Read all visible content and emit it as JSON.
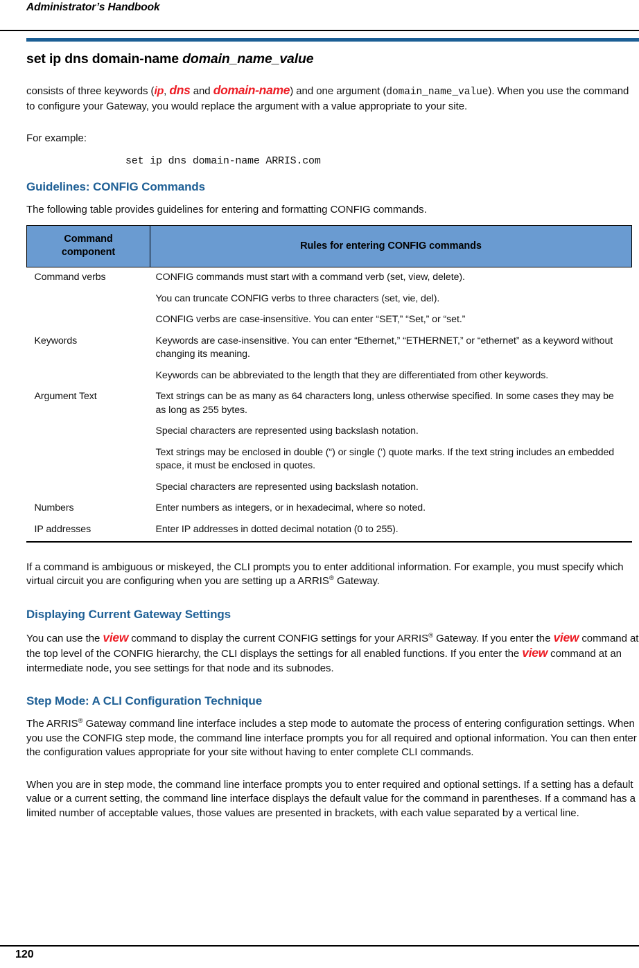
{
  "header": {
    "running_head": "Administrator’s Handbook",
    "accent_color": "#1B5E94"
  },
  "command_title": {
    "command": "set ip dns domain-name ",
    "argument": "domain_name_value"
  },
  "intro": {
    "p1_a": "consists of three keywords (",
    "kw_ip": "ip",
    "p1_b": ", ",
    "kw_dns": "dns",
    "p1_c": " and ",
    "kw_domain_name": "domain-name",
    "p1_d": ") and one argument (",
    "arg_mono": "domain_name_value",
    "p1_e": "). When you use the command to configure your Gateway, you would replace the argument with a value appropriate to your site.",
    "for_example": "For example:",
    "example_code": "set ip dns domain-name ARRIS.com"
  },
  "guidelines_section": {
    "heading": "Guidelines: CONFIG Commands",
    "lead": "The following table provides guidelines for entering and formatting CONFIG commands.",
    "table": {
      "headers": [
        "Command component",
        "Rules for entering CONFIG commands"
      ],
      "header_col1_line1": "Command",
      "header_col1_line2": "component",
      "header_col2": "Rules for entering CONFIG commands",
      "rows": [
        {
          "component": "Command verbs",
          "rules": [
            "CONFIG commands must start with a command verb (set, view, delete).",
            "You can truncate CONFIG verbs to three characters (set, vie, del).",
            "CONFIG verbs are case-insensitive. You can enter “SET,” “Set,” or “set.”"
          ]
        },
        {
          "component": "Keywords",
          "rules": [
            "Keywords are case-insensitive. You can enter “Ethernet,” “ETHERNET,” or “ethernet” as a keyword without changing its meaning.",
            "Keywords can be abbreviated to the length that they are differentiated from other keywords."
          ]
        },
        {
          "component": "Argument Text",
          "rules": [
            "Text strings can be as many as 64 characters long, unless otherwise specified. In some cases they may be as long as 255 bytes.",
            "Special characters are represented using backslash notation.",
            "Text strings may be enclosed in double (“) or single (‘) quote marks. If the text string includes an embedded space, it must be enclosed in quotes.",
            "Special characters are represented using backslash notation."
          ]
        },
        {
          "component": "Numbers",
          "rules": [
            "Enter numbers as integers, or in hexadecimal, where so noted."
          ]
        },
        {
          "component": "IP addresses",
          "rules": [
            "Enter IP addresses in dotted decimal notation (0 to 255)."
          ]
        }
      ]
    },
    "after_table_a": "If a command is ambiguous or miskeyed, the CLI prompts you to enter additional information. For example, you must specify which virtual circuit you are configuring when you are setting up a ARRIS",
    "after_table_sup": "®",
    "after_table_b": " Gateway."
  },
  "displaying_section": {
    "heading": "Displaying Current Gateway Settings",
    "p_a": "You can use the ",
    "kw_view_1": "view",
    "p_b": " command to display the current CONFIG settings for your ARRIS",
    "sup": "®",
    "p_c": " Gateway. If you enter the ",
    "kw_view_2": "view",
    "p_d": "  command at the top level of the CONFIG hierarchy, the CLI displays the settings for all enabled functions. If you enter the ",
    "kw_view_3": "view",
    "p_e": " command at an intermediate node, you see settings for that node and its subnodes."
  },
  "step_mode_section": {
    "heading": "Step Mode: A CLI Configuration Technique",
    "p1_a": "The ARRIS",
    "p1_sup": "®",
    "p1_b": " Gateway command line interface includes a step mode to automate the process of entering configuration settings. When you use the CONFIG step mode, the command line interface prompts you for all required and optional information. You can then enter the configuration values appropriate for your site without having to enter complete CLI commands.",
    "p2": "When you are in step mode, the command line interface prompts you to enter required and optional settings. If a setting has a default value or a current setting, the command line interface displays the default value for the command in parentheses. If a command has a limited number of acceptable values, those values are presented in brackets, with each value separated by a vertical line."
  },
  "footer": {
    "page_number": "120"
  }
}
